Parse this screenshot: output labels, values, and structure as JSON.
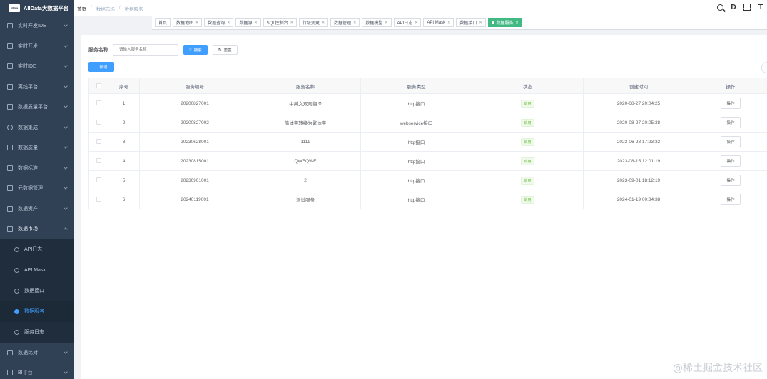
{
  "app": {
    "title": "AllData大数据平台",
    "logo_text": "AllData"
  },
  "sidebar": {
    "items": [
      {
        "label": "实时开发IDE",
        "icon": "monitor-icon"
      },
      {
        "label": "实时开发",
        "icon": "monitor-icon"
      },
      {
        "label": "实时IDE",
        "icon": "send-icon"
      },
      {
        "label": "离线平台",
        "icon": "send-icon"
      },
      {
        "label": "数据质量平台",
        "icon": "grid-icon"
      },
      {
        "label": "数据集成",
        "icon": "compass-icon"
      },
      {
        "label": "数据质量",
        "icon": "grid-icon"
      },
      {
        "label": "数据标准",
        "icon": "send-icon"
      },
      {
        "label": "元数据管理",
        "icon": "send-icon"
      },
      {
        "label": "数据资产",
        "icon": "grid-icon"
      },
      {
        "label": "数据市场",
        "icon": "list-icon"
      }
    ],
    "market_sub": [
      {
        "label": "API日志",
        "icon": "user-icon"
      },
      {
        "label": "API Mask",
        "icon": "compass-icon"
      },
      {
        "label": "数据接口",
        "icon": "cloud-icon"
      },
      {
        "label": "数据服务",
        "icon": "cloud-icon"
      },
      {
        "label": "服务日志",
        "icon": "cloud-icon"
      }
    ],
    "after": [
      {
        "label": "数据比对",
        "icon": "grid-icon"
      },
      {
        "label": "BI平台",
        "icon": "chart-icon"
      }
    ]
  },
  "breadcrumb": [
    "首页",
    "数据市场",
    "数据服务"
  ],
  "navbar": {
    "icon_d": "D",
    "icon_more": "⊤"
  },
  "tags": [
    {
      "label": "首页",
      "closable": false
    },
    {
      "label": "数据地图",
      "closable": true
    },
    {
      "label": "数据查询",
      "closable": true
    },
    {
      "label": "数据源",
      "closable": true
    },
    {
      "label": "SQL控制台",
      "closable": true
    },
    {
      "label": "行级变更",
      "closable": true
    },
    {
      "label": "数据管理",
      "closable": true
    },
    {
      "label": "数据模型",
      "closable": true
    },
    {
      "label": "API日志",
      "closable": true
    },
    {
      "label": "API Mask",
      "closable": true
    },
    {
      "label": "数据接口",
      "closable": true
    },
    {
      "label": "数据服务",
      "closable": true,
      "active": true
    }
  ],
  "search": {
    "label": "服务名称",
    "placeholder": "请输入服务名称",
    "search_btn": "搜索",
    "reset_btn": "重置",
    "add_btn": "新增"
  },
  "table": {
    "headers": [
      "序号",
      "服务编号",
      "服务名称",
      "服务类型",
      "状态",
      "创建时间",
      "操作"
    ],
    "rows": [
      {
        "idx": "1",
        "code": "20200827001",
        "name": "中英文双向翻译",
        "type": "http接口",
        "status": "启用",
        "created": "2020-08-27 20:04:25",
        "op": "操作"
      },
      {
        "idx": "2",
        "code": "20200827002",
        "name": "简体字转换为繁体字",
        "type": "webservice接口",
        "status": "启用",
        "created": "2020-08-27 20:05:38",
        "op": "操作"
      },
      {
        "idx": "3",
        "code": "20230628001",
        "name": "1111",
        "type": "http接口",
        "status": "启用",
        "created": "2023-06-28 17:23:32",
        "op": "操作"
      },
      {
        "idx": "4",
        "code": "20230815001",
        "name": "QWEQWE",
        "type": "http接口",
        "status": "启用",
        "created": "2023-08-15 12:01:19",
        "op": "操作"
      },
      {
        "idx": "5",
        "code": "20230901001",
        "name": "2",
        "type": "http接口",
        "status": "启用",
        "created": "2023-09-01 18:12:19",
        "op": "操作"
      },
      {
        "idx": "6",
        "code": "20240119001",
        "name": "测试服务",
        "type": "http接口",
        "status": "启用",
        "created": "2024-01-19 00:34:38",
        "op": "操作"
      }
    ]
  },
  "watermark": "@稀土掘金技术社区",
  "colors": {
    "sidebar_bg": "#304156",
    "primary": "#409eff",
    "active_tag": "#42b983",
    "status_green": "#67c23a"
  }
}
